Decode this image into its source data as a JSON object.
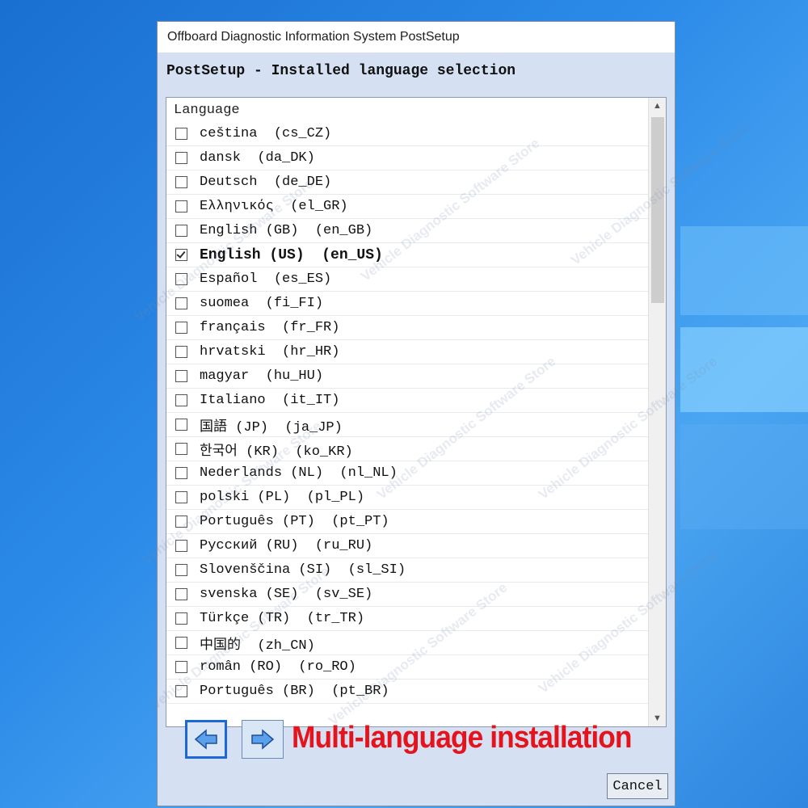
{
  "window": {
    "title": "Offboard Diagnostic Information System PostSetup",
    "header": "PostSetup - Installed language selection"
  },
  "list": {
    "column_header": "Language",
    "items": [
      {
        "label": "ceština  (cs_CZ)",
        "checked": false
      },
      {
        "label": "dansk  (da_DK)",
        "checked": false
      },
      {
        "label": "Deutsch  (de_DE)",
        "checked": false
      },
      {
        "label": "Ελληνικός  (el_GR)",
        "checked": false
      },
      {
        "label": "English (GB)  (en_GB)",
        "checked": false
      },
      {
        "label": "English (US)  (en_US)",
        "checked": true
      },
      {
        "label": "Español  (es_ES)",
        "checked": false
      },
      {
        "label": "suomea  (fi_FI)",
        "checked": false
      },
      {
        "label": "français  (fr_FR)",
        "checked": false
      },
      {
        "label": "hrvatski  (hr_HR)",
        "checked": false
      },
      {
        "label": "magyar  (hu_HU)",
        "checked": false
      },
      {
        "label": "Italiano  (it_IT)",
        "checked": false
      },
      {
        "label": "国語 (JP)  (ja_JP)",
        "checked": false
      },
      {
        "label": "한국어 (KR)  (ko_KR)",
        "checked": false
      },
      {
        "label": "Nederlands (NL)  (nl_NL)",
        "checked": false
      },
      {
        "label": "polski (PL)  (pl_PL)",
        "checked": false
      },
      {
        "label": "Português (PT)  (pt_PT)",
        "checked": false
      },
      {
        "label": "Русский (RU)  (ru_RU)",
        "checked": false
      },
      {
        "label": "Slovenščina (SI)  (sl_SI)",
        "checked": false
      },
      {
        "label": "svenska (SE)  (sv_SE)",
        "checked": false
      },
      {
        "label": "Türkçe (TR)  (tr_TR)",
        "checked": false
      },
      {
        "label": "中国的  (zh_CN)",
        "checked": false
      },
      {
        "label": "român (RO)  (ro_RO)",
        "checked": false
      },
      {
        "label": "Português (BR)  (pt_BR)",
        "checked": false
      }
    ]
  },
  "buttons": {
    "cancel_label": "Cancel"
  },
  "promo_text": "Multi-language installation",
  "watermark_text": "Vehicle Diagnostic Software Store",
  "colors": {
    "promo": "#e5141c",
    "nav_arrow": "#1d68d8",
    "window_bg": "#d5e1f2"
  },
  "icons": {
    "back": "left-arrow-icon",
    "forward": "right-arrow-icon"
  }
}
